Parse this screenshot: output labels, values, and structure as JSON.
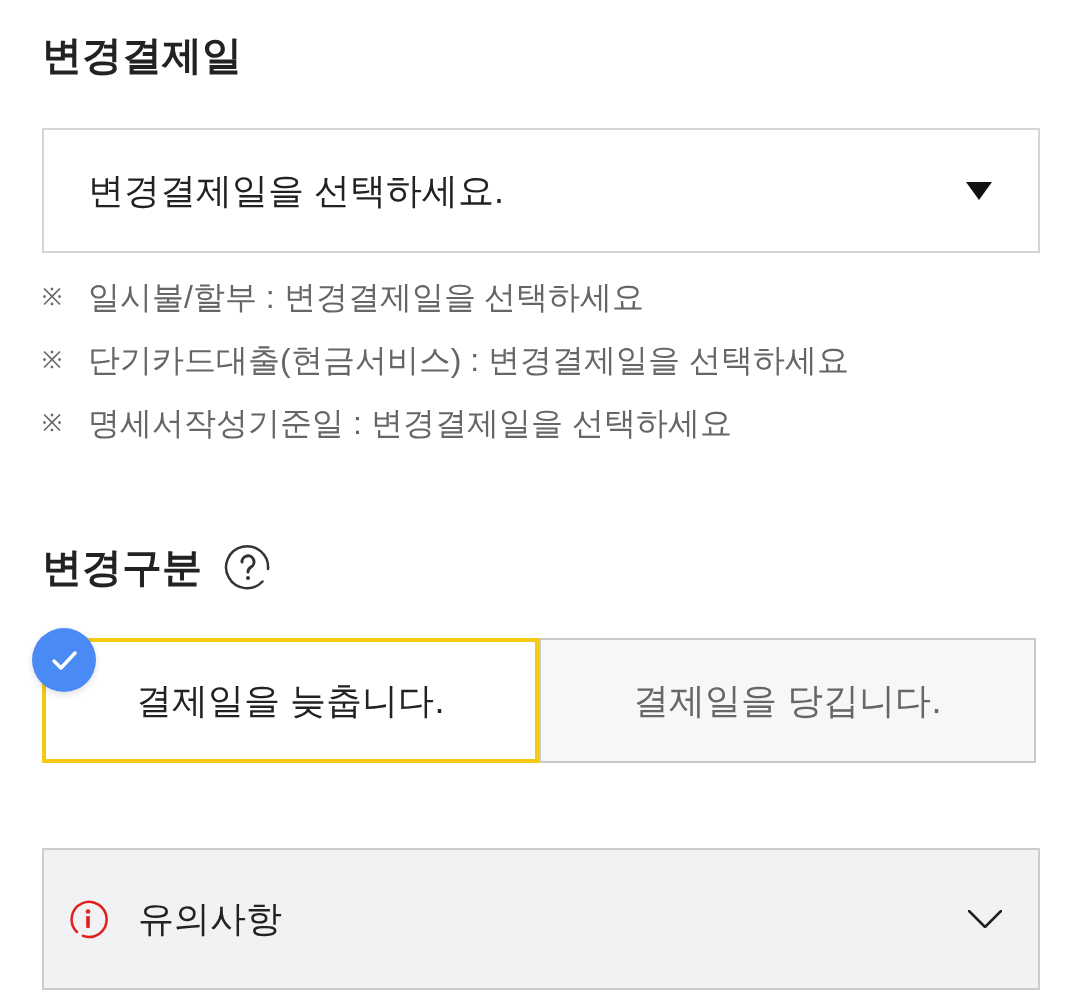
{
  "payment_date": {
    "title": "변경결제일",
    "select": {
      "value": "변경결제일을 선택하세요."
    },
    "notes": [
      {
        "symbol": "※",
        "text": "일시불/할부 : 변경결제일을 선택하세요"
      },
      {
        "symbol": "※",
        "text": "단기카드대출(현금서비스) : 변경결제일을 선택하세요"
      },
      {
        "symbol": "※",
        "text": "명세서작성기준일 : 변경결제일을 선택하세요"
      }
    ]
  },
  "change_type": {
    "title": "변경구분",
    "options": [
      {
        "label": "결제일을 늦춥니다.",
        "selected": true
      },
      {
        "label": "결제일을 당깁니다.",
        "selected": false
      }
    ]
  },
  "notice": {
    "title": "유의사항",
    "expanded": false
  }
}
